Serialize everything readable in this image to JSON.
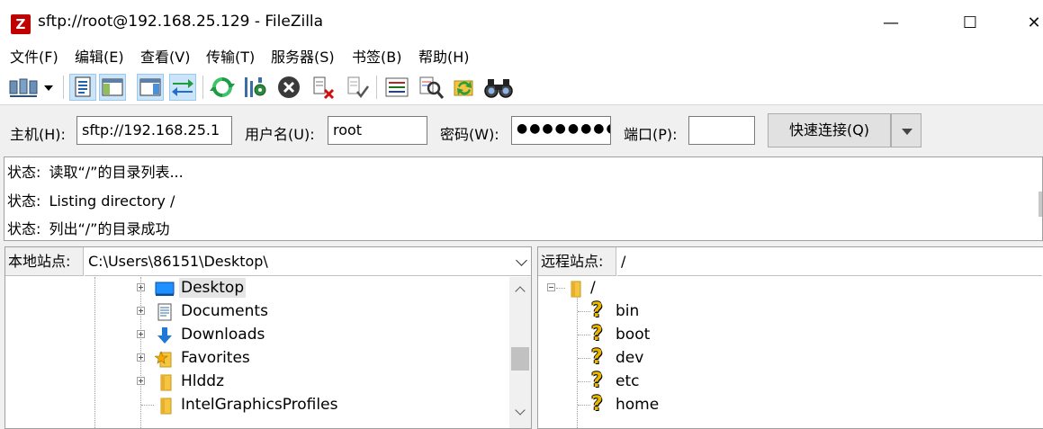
{
  "window": {
    "title": "sftp://root@192.168.25.129 - FileZilla",
    "app_icon_letter": "Z",
    "minimize": "—",
    "maximize": "☐",
    "close": "✕"
  },
  "menu": [
    {
      "label": "文件(F)"
    },
    {
      "label": "编辑(E)"
    },
    {
      "label": "查看(V)"
    },
    {
      "label": "传输(T)"
    },
    {
      "label": "服务器(S)"
    },
    {
      "label": "书签(B)"
    },
    {
      "label": "帮助(H)"
    }
  ],
  "toolbar": {
    "icons": [
      "site-manager-icon",
      "message-log-icon",
      "local-tree-icon",
      "remote-tree-icon",
      "transfer-queue-icon",
      "refresh-icon",
      "process-queue-icon",
      "cancel-icon",
      "disconnect-icon",
      "reconnect-icon",
      "directory-filter-icon",
      "toggle-comparison-icon",
      "synchronized-browsing-icon",
      "search-remote-icon"
    ]
  },
  "connection": {
    "host_label": "主机(H):",
    "host_value": "sftp://192.168.25.1",
    "user_label": "用户名(U):",
    "user_value": "root",
    "pass_label": "密码(W):",
    "pass_value": "●●●●●●●●",
    "port_label": "端口(P):",
    "port_value": "",
    "quickconnect_label": "快速连接(Q)"
  },
  "log": [
    {
      "prefix": "状态:",
      "text": "读取“/”的目录列表..."
    },
    {
      "prefix": "状态:",
      "text": "Listing directory /"
    },
    {
      "prefix": "状态:",
      "text": "列出“/”的目录成功"
    }
  ],
  "local": {
    "label": "本地站点:",
    "path": "C:\\Users\\86151\\Desktop\\",
    "items": [
      {
        "label": "Desktop",
        "icon": "desktop-icon",
        "expander": "plus",
        "selected": true
      },
      {
        "label": "Documents",
        "icon": "documents-icon",
        "expander": "plus"
      },
      {
        "label": "Downloads",
        "icon": "downloads-icon",
        "expander": "plus"
      },
      {
        "label": "Favorites",
        "icon": "favorites-icon",
        "expander": "plus"
      },
      {
        "label": "Hlddz",
        "icon": "folder-icon",
        "expander": "plus"
      },
      {
        "label": "IntelGraphicsProfiles",
        "icon": "folder-icon",
        "expander": "none"
      }
    ]
  },
  "remote": {
    "label": "远程站点:",
    "path": "/",
    "root": "/",
    "items": [
      {
        "label": "bin"
      },
      {
        "label": "boot"
      },
      {
        "label": "dev"
      },
      {
        "label": "etc"
      },
      {
        "label": "home"
      }
    ]
  },
  "colors": {
    "accent_blue": "#0078d7",
    "selection": "#cce4f7",
    "folder": "#f5c542",
    "question_mark": "#e9b600"
  }
}
